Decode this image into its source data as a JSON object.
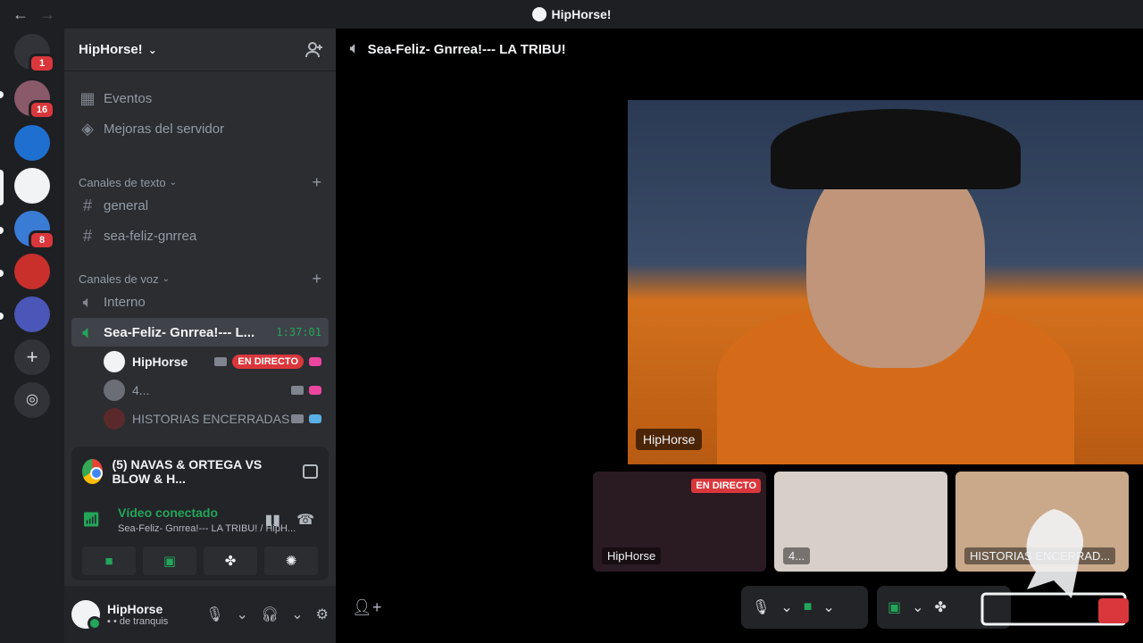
{
  "app": {
    "title": "HipHorse!"
  },
  "servers": [
    {
      "name": "dm",
      "badge": "1",
      "color": "#5865f2"
    },
    {
      "name": "s1",
      "badge": "16",
      "color": "#8a5a6a"
    },
    {
      "name": "s2",
      "badge": "",
      "color": "#1f6fd1"
    },
    {
      "name": "s3",
      "badge": "",
      "color": "#f2f3f5"
    },
    {
      "name": "s4",
      "badge": "8",
      "color": "#3a7bd5"
    },
    {
      "name": "s5",
      "badge": "",
      "color": "#c9302c"
    },
    {
      "name": "s6",
      "badge": "",
      "color": "#4a57b8"
    }
  ],
  "guild": {
    "name": "HipHorse!"
  },
  "nav": {
    "events": "Eventos",
    "boosts": "Mejoras del servidor"
  },
  "text_category": "Canales de texto",
  "text_channels": [
    "general",
    "sea-feliz-gnrrea"
  ],
  "voice_category": "Canales de voz",
  "voice_channels": {
    "internal": "Interno",
    "active": "Sea-Feliz- Gnrrea!--- L...",
    "timer": "1:37:01"
  },
  "voice_users": [
    {
      "name": "HipHorse",
      "live": "EN DIRECTO"
    },
    {
      "name": "4..."
    },
    {
      "name": "HISTORIAS ENCERRADAS"
    }
  ],
  "stream": {
    "title": "(5) NAVAS & ORTEGA VS BLOW & H..."
  },
  "connection": {
    "status": "Vídeo conectado",
    "detail": "Sea-Feliz- Gnrrea!--- LA TRIBU! / HipH..."
  },
  "user": {
    "name": "HipHorse",
    "status": "de tranquis"
  },
  "main": {
    "channel": "Sea-Feliz- Gnrrea!--- LA TRIBU!",
    "speaker_tag": "HipHorse",
    "thumbs": [
      {
        "label": "HipHorse",
        "live": "EN DIRECTO"
      },
      {
        "label": "4..."
      },
      {
        "label": "HISTORIAS ENCERRAD..."
      }
    ]
  }
}
